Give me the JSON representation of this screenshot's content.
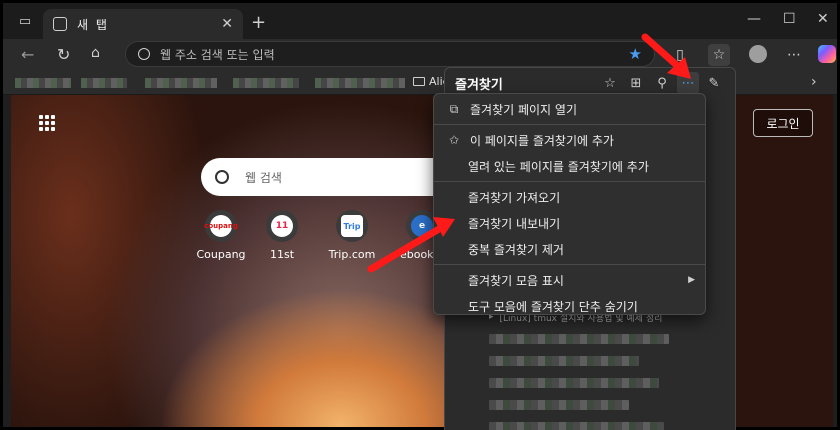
{
  "tab": {
    "title": "새 탭"
  },
  "address_bar": {
    "placeholder": "웹 주소 검색 또는 입력"
  },
  "bookmarks_bar": {
    "folder_label": "Alie"
  },
  "new_tab_page": {
    "search_placeholder": "웹 검색",
    "login_label": "로그인",
    "quick_links": [
      {
        "label": "Coupang",
        "icon_text": "coupang"
      },
      {
        "label": "11st",
        "icon_text": "11"
      },
      {
        "label": "Trip.com",
        "icon_text": "Trip"
      },
      {
        "label": "ebook n",
        "icon_text": "e"
      }
    ]
  },
  "favorites_panel": {
    "title": "즐겨찾기",
    "visible_item": "[Linux] tmux 설치와 사용법 및 예제 정리"
  },
  "favorites_menu": {
    "items": [
      {
        "label": "즐겨찾기 페이지 열기",
        "icon": "external-link-icon"
      },
      {
        "label": "이 페이지를 즐겨찾기에 추가",
        "icon": "star-add-icon"
      },
      {
        "label": "열려 있는 페이지를 즐겨찾기에 추가",
        "icon": ""
      },
      {
        "label": "즐겨찾기 가져오기",
        "icon": ""
      },
      {
        "label": "즐겨찾기 내보내기",
        "icon": ""
      },
      {
        "label": "중복 즐겨찾기 제거",
        "icon": ""
      },
      {
        "label": "즐겨찾기 모음 표시",
        "icon": "",
        "submenu": true
      },
      {
        "label": "도구 모음에 즐겨찾기 단추 숨기기",
        "icon": ""
      }
    ]
  },
  "colors": {
    "accent": "#4b9cf0",
    "annotation": "#ff1a1a"
  }
}
